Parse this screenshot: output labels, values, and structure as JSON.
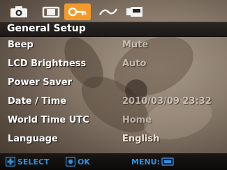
{
  "tabs": [
    {
      "icon": "camera-icon"
    },
    {
      "icon": "movie-icon"
    },
    {
      "icon": "setup-key-icon",
      "active": true
    },
    {
      "icon": "playback-curve-icon"
    },
    {
      "icon": "print-icon"
    }
  ],
  "header": {
    "title": "General Setup"
  },
  "rows": [
    {
      "label": "Beep",
      "value": "Mute"
    },
    {
      "label": "LCD Brightness",
      "value": "Auto"
    },
    {
      "label": "Power Saver",
      "value": ""
    },
    {
      "label": "Date / Time",
      "value": "2010/03/09 23:32"
    },
    {
      "label": "World Time UTC",
      "value": "Home"
    },
    {
      "label": "Language",
      "value": "English"
    }
  ],
  "footer": {
    "select_label": "SELECT",
    "ok_label": "OK",
    "menu_label": "MENU:"
  },
  "colors": {
    "accent": "#f39a2a",
    "hint_blue": "#2f8fe0"
  }
}
